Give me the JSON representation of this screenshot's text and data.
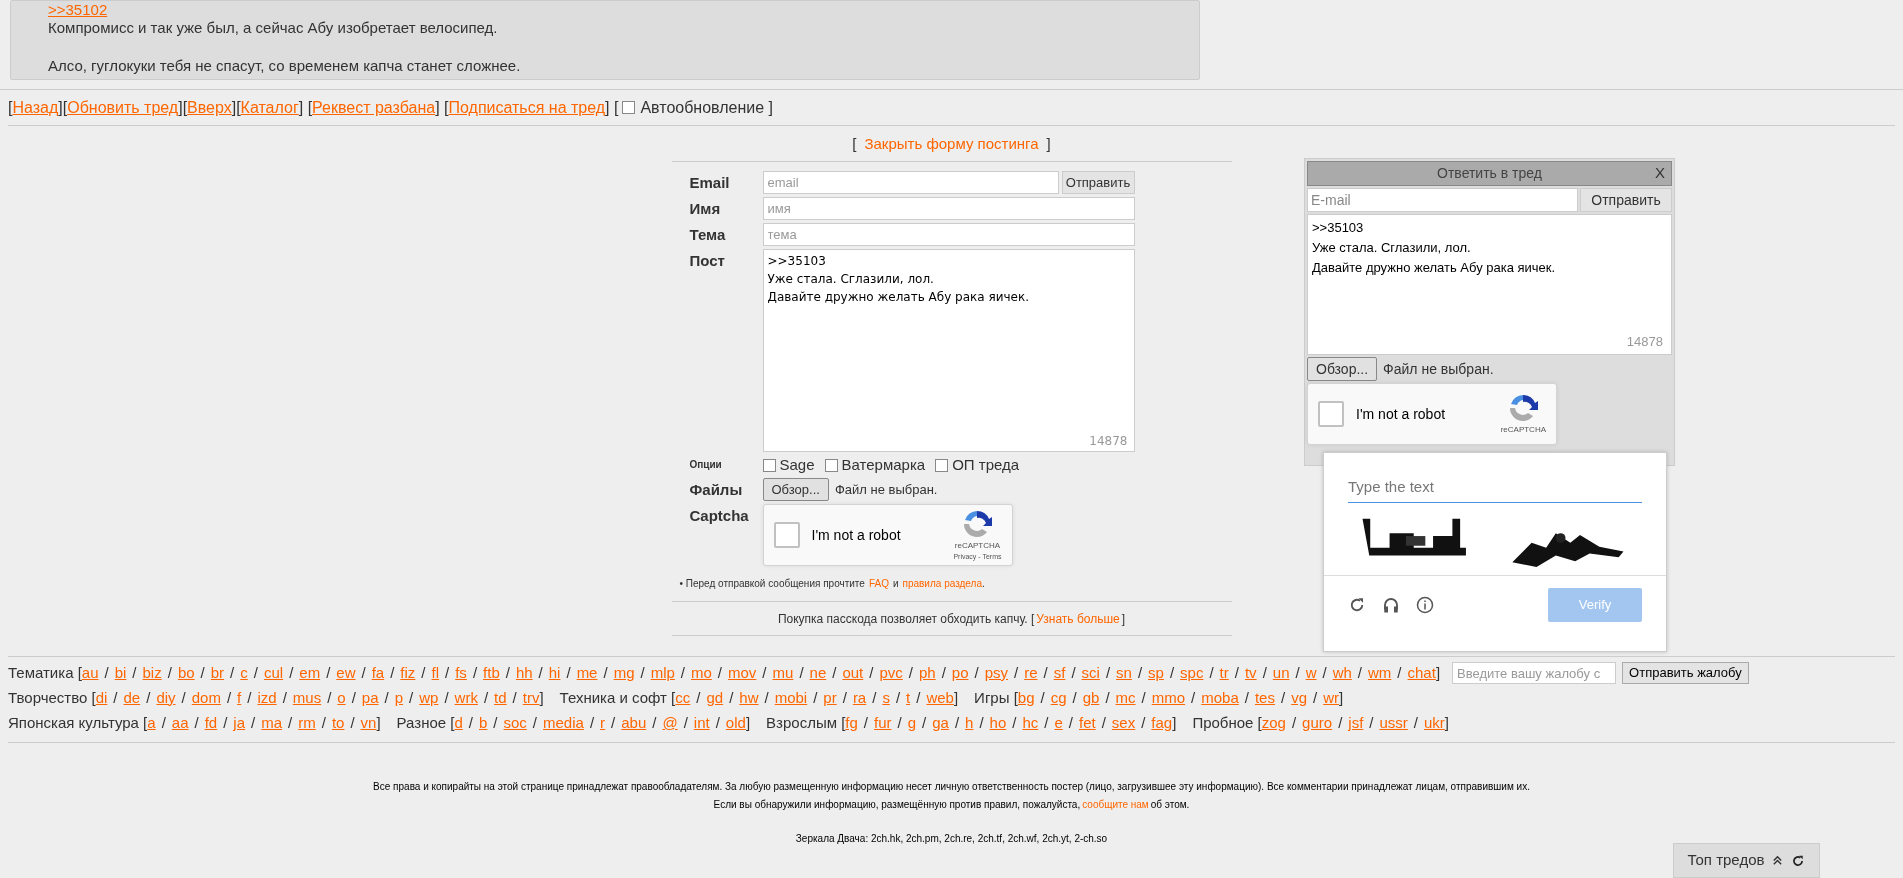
{
  "post": {
    "reply_link": ">>35102",
    "paragraphs": [
      "Компромисс и так уже был, а сейчас Абу изобретает велосипед.",
      "Алсо, гуглокуки тебя не спасут, со временем капча станет сложнее."
    ]
  },
  "nav": {
    "items": [
      {
        "kind": "text",
        "text": "["
      },
      {
        "kind": "link",
        "text": "Назад"
      },
      {
        "kind": "text",
        "text": "]["
      },
      {
        "kind": "link",
        "text": "Обновить тред"
      },
      {
        "kind": "text",
        "text": "]["
      },
      {
        "kind": "link",
        "text": "Вверх"
      },
      {
        "kind": "text",
        "text": "]["
      },
      {
        "kind": "link",
        "text": "Каталог"
      },
      {
        "kind": "text",
        "text": "] ["
      },
      {
        "kind": "link",
        "text": "Реквест разбана"
      },
      {
        "kind": "text",
        "text": "] ["
      },
      {
        "kind": "link",
        "text": "Подписаться на тред"
      },
      {
        "kind": "text",
        "text": "] ["
      }
    ],
    "autoupdate": {
      "label": "Автообновление ]",
      "checked": false
    }
  },
  "form": {
    "close_open": "[",
    "close_link": "Закрыть форму постинга",
    "close_end": "]",
    "fields": [
      {
        "label": "Email",
        "placeholder": "email"
      },
      {
        "label": "Имя",
        "placeholder": "имя"
      },
      {
        "label": "Тема",
        "placeholder": "тема"
      }
    ],
    "submit": "Отправить",
    "post_label": "Пост",
    "post_lines": [
      ">>35103",
      "Уже стала. Сглазили, лол.",
      "Давайте дружно желать Абу рака яичек."
    ],
    "counter": "14878",
    "options_label": "Опции",
    "options": [
      {
        "label": "Sage",
        "checked": false
      },
      {
        "label": "Ватермарка",
        "checked": false
      },
      {
        "label": "ОП треда",
        "checked": false
      }
    ],
    "files_label": "Файлы",
    "browse": "Обзор...",
    "no_file": "Файл не выбран.",
    "captcha_label": "Captcha",
    "recaptcha": {
      "label": "I'm not a robot",
      "checked": false,
      "brand": "reCAPTCHA",
      "legal": "Privacy - Terms"
    },
    "notice": [
      {
        "kind": "text",
        "text": "• Перед отправкой сообщения прочтите"
      },
      {
        "kind": "link",
        "text": "FAQ"
      },
      {
        "kind": "text",
        "text": "и"
      },
      {
        "kind": "link",
        "text": "правила раздела"
      },
      {
        "kind": "text",
        "text": "."
      }
    ],
    "passcode": [
      {
        "kind": "text",
        "text": "Покупка пасскода позволяет обходить капчу. ["
      },
      {
        "kind": "link",
        "text": "Узнать больше"
      },
      {
        "kind": "text",
        "text": "]"
      }
    ]
  },
  "quick_reply": {
    "title": "Ответить в тред",
    "close": "X",
    "email_placeholder": "E-mail",
    "submit": "Отправить",
    "post_lines": [
      ">>35103",
      "Уже стала. Сглазили, лол.",
      "Давайте дружно желать Абу рака яичек."
    ],
    "counter": "14878",
    "browse": "Обзор...",
    "no_file": "Файл не выбран.",
    "recaptcha": {
      "label": "I'm not a robot",
      "checked": false,
      "brand": "reCAPTCHA"
    }
  },
  "captcha_challenge": {
    "placeholder": "Type the text",
    "verify": "Verify"
  },
  "boards": {
    "rows": [
      [
        {
          "open": "Тематика [",
          "items": [
            "au",
            "/",
            "bi",
            "/",
            "biz",
            "/",
            "bo",
            "/",
            "br",
            "/",
            "c",
            "/",
            "cul",
            "/",
            "em",
            "/",
            "ew",
            "/",
            "fa",
            "/",
            "fiz",
            "/",
            "fl",
            "/",
            "fs",
            "/",
            "ftb",
            "/",
            "hh",
            "/",
            "hi",
            "/",
            "me",
            "/",
            "mg",
            "/",
            "mlp",
            "/",
            "mo",
            "/",
            "mov",
            "/",
            "mu",
            "/",
            "ne",
            "/",
            "out",
            "/",
            "pvc",
            "/",
            "ph",
            "/",
            "po",
            "/",
            "psy",
            "/",
            "re",
            "/",
            "sf",
            "/",
            "sci",
            "/",
            "sn",
            "/",
            "sp",
            "/",
            "spc",
            "/",
            "tr",
            "/",
            "tv",
            "/",
            "un",
            "/",
            "w",
            "/",
            "wh",
            "/",
            "wm",
            "/",
            "chat"
          ],
          "close": "]"
        }
      ],
      [
        {
          "open": "Творчество [",
          "items": [
            "di",
            "/",
            "de",
            "/",
            "diy",
            "/",
            "dom",
            "/",
            "f",
            "/",
            "izd",
            "/",
            "mus",
            "/",
            "o",
            "/",
            "pa",
            "/",
            "p",
            "/",
            "wp",
            "/",
            "wrk",
            "/",
            "td",
            "/",
            "trv"
          ],
          "close": "]"
        },
        {
          "open": "Техника и софт [",
          "items": [
            "cc",
            "/",
            "gd",
            "/",
            "hw",
            "/",
            "mobi",
            "/",
            "pr",
            "/",
            "ra",
            "/",
            "s",
            "/",
            "t",
            "/",
            "web"
          ],
          "close": "]"
        },
        {
          "open": "Игры [",
          "items": [
            "bg",
            "/",
            "cg",
            "/",
            "gb",
            "/",
            "mc",
            "/",
            "mmo",
            "/",
            "moba",
            "/",
            "tes",
            "/",
            "vg",
            "/",
            "wr"
          ],
          "close": "]"
        }
      ],
      [
        {
          "open": "Японская культура [",
          "items": [
            "a",
            "/",
            "aa",
            "/",
            "fd",
            "/",
            "ja",
            "/",
            "ma",
            "/",
            "rm",
            "/",
            "to",
            "/",
            "vn"
          ],
          "close": "]"
        },
        {
          "open": "Разное [",
          "items": [
            "d",
            "/",
            "b",
            "/",
            "soc",
            "/",
            "media",
            "/",
            "r",
            "/",
            "abu",
            "/",
            "@",
            "/",
            "int",
            "/",
            "old"
          ],
          "close": "]"
        },
        {
          "open": "Взрослым [",
          "items": [
            "fg",
            "/",
            "fur",
            "/",
            "g",
            "/",
            "ga",
            "/",
            "h",
            "/",
            "ho",
            "/",
            "hc",
            "/",
            "e",
            "/",
            "fet",
            "/",
            "sex",
            "/",
            "fag"
          ],
          "close": "]"
        },
        {
          "open": "Пробное [",
          "items": [
            "zog",
            "/",
            "guro",
            "/",
            "jsf",
            "/",
            "ussr",
            "/",
            "ukr"
          ],
          "close": "]"
        }
      ]
    ],
    "complaint_placeholder": "Введите вашу жалобу с",
    "complaint_button": "Отправить жалобу"
  },
  "footer": {
    "copyright": "Все права и копирайты на этой странице принадлежат правообладателям. За любую размещенную информацию несет личную ответственность постер (лицо, загрузившее эту информацию). Все комментарии принадлежат лицам, отправившим их.",
    "report": [
      {
        "kind": "text",
        "text": "Если вы обнаружили информацию, размещённую против правил, пожалуйста,"
      },
      {
        "kind": "link",
        "text": "сообщите нам"
      },
      {
        "kind": "text",
        "text": "об этом."
      }
    ],
    "mirrors": "Зеркала Двача: 2ch.hk, 2ch.pm, 2ch.re, 2ch.tf, 2ch.wf, 2ch.yt, 2-ch.so",
    "top_threads": "Топ тредов"
  }
}
